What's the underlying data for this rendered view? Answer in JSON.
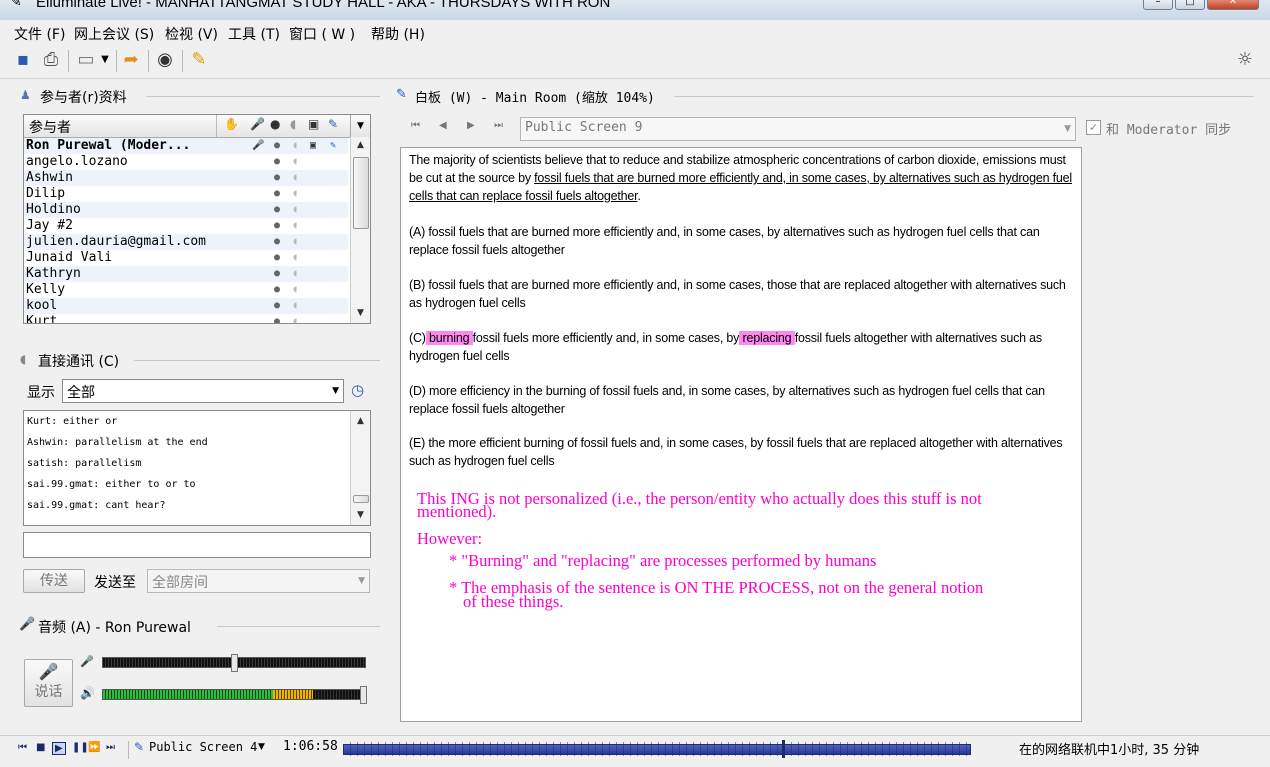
{
  "window": {
    "title": "Elluminate Live! - MANHATTANGMAT STUDY HALL - AKA - THURSDAYS WITH RON"
  },
  "menu": [
    "文件 (F)",
    "网上会议 (S)",
    "检视 (V)",
    "工具 (T)",
    "窗口 ( W )",
    "帮助 (H)"
  ],
  "participants": {
    "title": "参与者(r)资料",
    "column_header": "参与者",
    "rows": [
      "Ron Purewal (Moder...",
      "angelo.lozano",
      "Ashwin",
      "Dilip",
      "Holdino",
      "Jay #2",
      "julien.dauria@gmail.com",
      "Junaid Vali",
      "Kathryn",
      "Kelly",
      "kool",
      "Kurt"
    ]
  },
  "chat": {
    "title": "直接通讯 (C)",
    "show_label": "显示",
    "filter_value": "全部",
    "messages": [
      "Kurt: either or",
      "Ashwin: parallelism at the end",
      "satish: parallelism",
      "sai.99.gmat: either to or to",
      "sai.99.gmat: cant hear?"
    ],
    "input_value": "",
    "send_button": "传送",
    "send_to_label": "发送至",
    "send_to_value": "全部房间"
  },
  "audio": {
    "title": "音频 (A) - Ron Purewal",
    "talk_button": "说话",
    "mic_level": 0.5,
    "speaker_level": 1.0
  },
  "whiteboard": {
    "title": "白板 (W) - Main Room (缩放 104%)",
    "screen_selector": "Public Screen 9",
    "sync_label": "和 Moderator 同步",
    "sync_checked": true,
    "question": {
      "stem_lead": "The majority of scientists believe that to reduce and stabilize atmospheric concentrations of carbon dioxide, emissions must be cut at the source by ",
      "stem_underlined": "fossil fuels that are burned more efficiently and, in some cases, by alternatives such as hydrogen fuel cells that can replace fossil fuels altogether",
      "stem_end": ".",
      "a": "(A) fossil fuels that are burned more efficiently and, in some cases, by alternatives such as hydrogen fuel cells that can replace fossil fuels altogether",
      "b": "(B) fossil fuels that are burned more efficiently and, in some cases, those that are replaced altogether with alternatives such as hydrogen fuel cells",
      "c_pre": "(C)",
      "c_hl1": " burning ",
      "c_mid": " fossil fuels more efficiently and, in some cases, by",
      "c_hl2": " replacing ",
      "c_post": " fossil fuels altogether with alternatives such as hydrogen fuel cells",
      "d": "(D) more efficiency in the burning of fossil fuels and, in some cases, by alternatives such as hydrogen fuel cells that can replace fossil fuels altogether",
      "e": "(E) the more efficient burning of fossil fuels and, in some cases, by fossil fuels that are replaced altogether with alternatives such as hydrogen fuel cells"
    },
    "annotations": {
      "line1": "This ING is not personalized (i.e., the person/entity who actually does this stuff is not",
      "line1b": "mentioned).",
      "line2": "However:",
      "line3": "* \"Burning\" and \"replacing\" are processes performed by humans",
      "line4": "* The emphasis of the sentence is ON THE PROCESS, not on the general notion",
      "line4b": "of these things.",
      "color": "#ff00cc"
    }
  },
  "playback": {
    "screen": "Public Screen 4",
    "time": "1:06:58",
    "status": "在的网络联机中1小时, 35 分钟",
    "position": 0.7
  }
}
